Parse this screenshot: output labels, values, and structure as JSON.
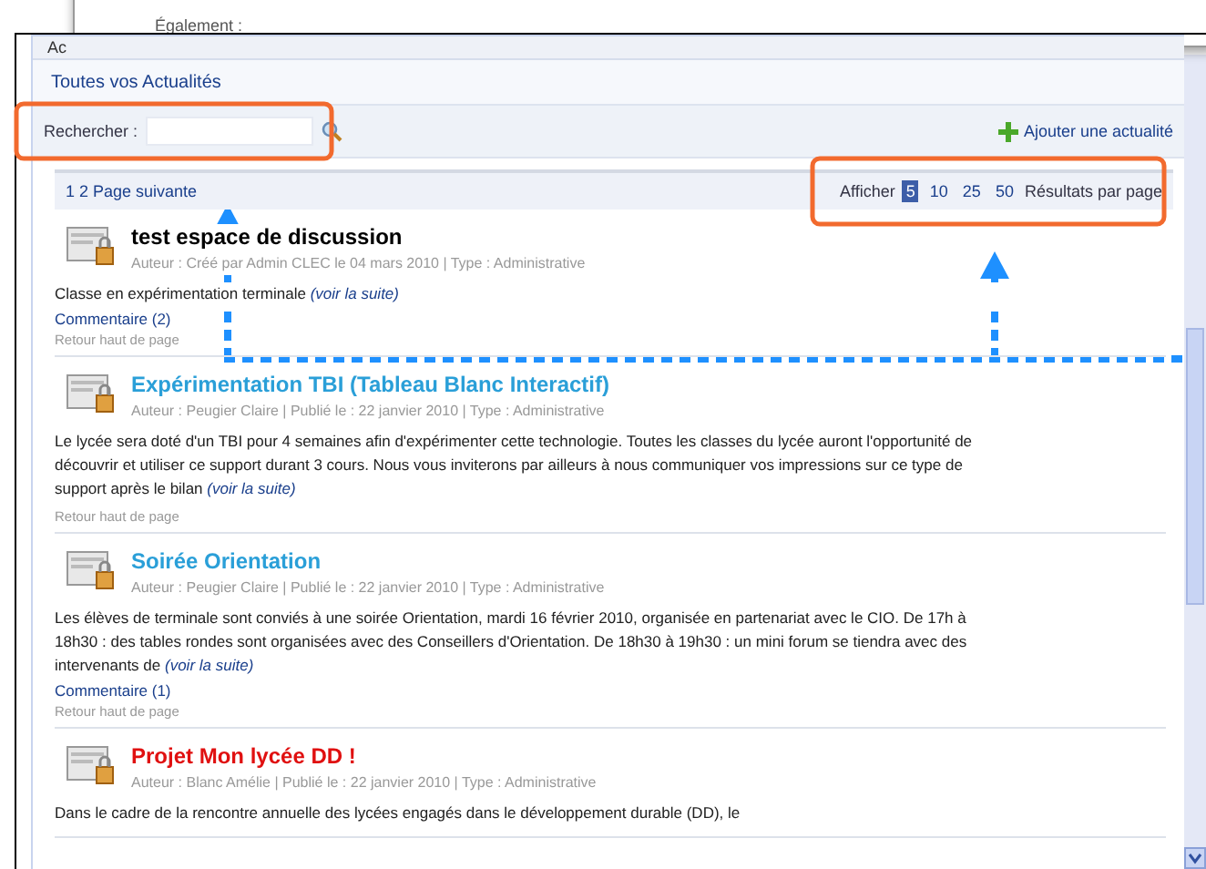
{
  "popup": {
    "text": "Également :"
  },
  "tab": {
    "label": "Ac"
  },
  "header": {
    "title": "Toutes vos Actualités"
  },
  "search": {
    "label": "Rechercher :",
    "add_label": "Ajouter une actualité"
  },
  "pager": {
    "pages": "1 2 Page suivante",
    "show_label": "Afficher",
    "sizes": [
      {
        "label": "5",
        "selected": true
      },
      {
        "label": "10",
        "selected": false
      },
      {
        "label": "25",
        "selected": false
      },
      {
        "label": "50",
        "selected": false
      }
    ],
    "per_page_label": "Résultats par page"
  },
  "articles": [
    {
      "title": "test espace de discussion",
      "color": "#000000",
      "meta": "Auteur : Créé par Admin CLEC le 04 mars 2010 | Type : Administrative",
      "body": "Classe en expérimentation terminale",
      "more": "(voir la suite)",
      "comments": "Commentaire (2)",
      "back": "Retour haut de page"
    },
    {
      "title": "Expérimentation TBI (Tableau Blanc Interactif)",
      "color": "#2a9fd8",
      "meta": "Auteur : Peugier Claire | Publié le : 22 janvier 2010 | Type : Administrative",
      "body": "Le lycée sera doté d'un TBI pour 4 semaines afin d'expérimenter cette technologie. Toutes les classes du lycée auront l'opportunité de découvrir et utiliser ce support durant 3 cours. Nous vous inviterons par ailleurs à nous communiquer vos impressions sur ce type de support après le bilan",
      "more": "(voir la suite)",
      "back": "Retour haut de page"
    },
    {
      "title": "Soirée Orientation",
      "color": "#2a9fd8",
      "meta": "Auteur : Peugier Claire | Publié le : 22 janvier 2010 | Type : Administrative",
      "body": "Les élèves de terminale sont conviés à une soirée Orientation, mardi 16 février 2010, organisée en partenariat avec le CIO. De 17h à 18h30 : des tables rondes sont organisées avec des Conseillers d'Orientation. De 18h30 à 19h30 : un mini forum se tiendra avec des intervenants de",
      "more": "(voir la suite)",
      "comments": "Commentaire (1)",
      "back": "Retour haut de page"
    },
    {
      "title": "Projet Mon lycée DD !",
      "color": "#e01010",
      "meta": "Auteur : Blanc Amélie | Publié le : 22 janvier 2010 | Type : Administrative",
      "body": "Dans le cadre de la rencontre annuelle des lycées engagés dans le développement durable (DD), le"
    }
  ]
}
